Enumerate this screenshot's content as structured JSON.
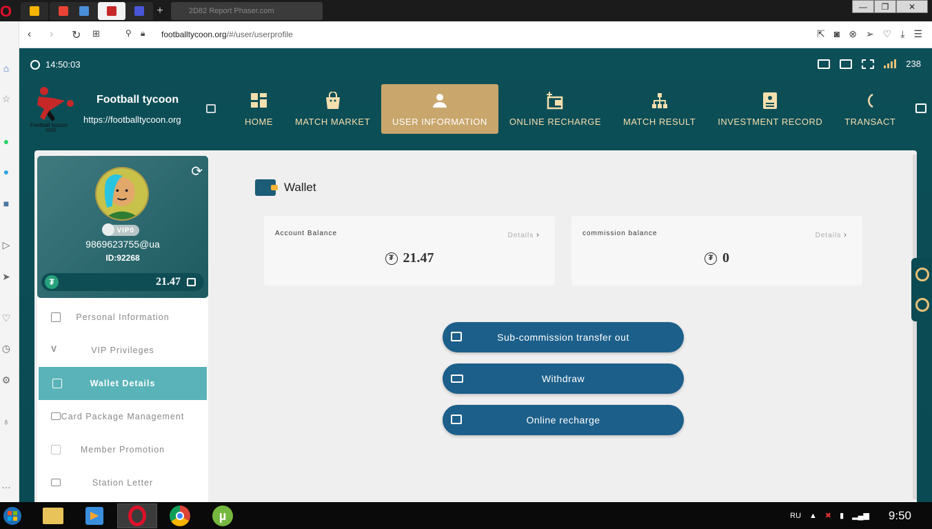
{
  "browser": {
    "url_host": "footballtycoon.org",
    "url_path": "/#/user/userprofile",
    "blur_tab": "2D82 Report Phaser.com"
  },
  "site": {
    "clock": "14:50:03",
    "signal_value": "238",
    "brand_title": "Football tycoon",
    "brand_url": "https://footballtycoon.org",
    "logo_text": "Football tycoon",
    "logo_year": "2022",
    "nav": [
      {
        "label": "HOME",
        "icon": "grid-icon"
      },
      {
        "label": "MATCH MARKET",
        "icon": "bag-icon"
      },
      {
        "label": "USER INFORMATION",
        "icon": "user-icon",
        "active": true
      },
      {
        "label": "ONLINE RECHARGE",
        "icon": "recharge-icon"
      },
      {
        "label": "MATCH RESULT",
        "icon": "hierarchy-icon"
      },
      {
        "label": "INVESTMENT RECORD",
        "icon": "record-icon"
      },
      {
        "label": "TRANSACT",
        "icon": "transact-icon"
      }
    ]
  },
  "profile": {
    "vip": "VIP0",
    "phone": "9869623755@ua",
    "id": "ID:92268",
    "balance": "21.47",
    "currency_symbol": "₮"
  },
  "menu": [
    {
      "label": "Personal Information"
    },
    {
      "label": "VIP Privileges"
    },
    {
      "label": "Wallet Details",
      "active": true
    },
    {
      "label": "Card Package Management"
    },
    {
      "label": "Member Promotion"
    },
    {
      "label": "Station Letter"
    }
  ],
  "wallet": {
    "title": "Wallet",
    "account_label": "Account Balance",
    "account_value": "21.47",
    "commission_label": "commission balance",
    "commission_value": "0",
    "details_label": "Details",
    "buttons": [
      "Sub-commission transfer out",
      "Withdraw",
      "Online recharge"
    ]
  },
  "taskbar": {
    "lang": "RU",
    "time": "9:50"
  },
  "colors": {
    "teal_bg": "#0d4f57",
    "gold": "#c8a66c",
    "nav_text": "#f5dfae",
    "button_blue": "#1c5f8a",
    "active_menu": "#5ab3b8"
  }
}
